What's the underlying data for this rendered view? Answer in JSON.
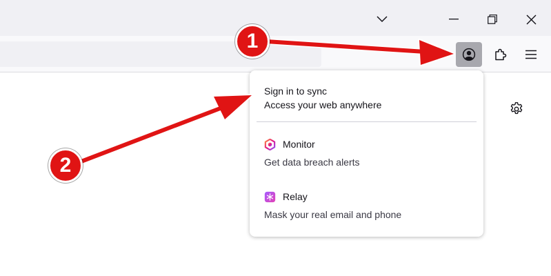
{
  "window": {
    "controls": {
      "tabs_dropdown_icon": "chevron-down-icon",
      "minimize_icon": "minimize-icon",
      "restore_icon": "restore-icon",
      "close_icon": "close-icon"
    }
  },
  "toolbar": {
    "account_icon": "account-icon",
    "extensions_icon": "puzzle-icon",
    "menu_icon": "hamburger-menu-icon"
  },
  "content": {
    "settings_icon": "gear-icon"
  },
  "account_panel": {
    "sync_title": "Sign in to sync",
    "sync_subtitle": "Access your web anywhere",
    "items": [
      {
        "icon": "monitor-icon",
        "title": "Monitor",
        "subtitle": "Get data breach alerts"
      },
      {
        "icon": "relay-icon",
        "title": "Relay",
        "subtitle": "Mask your real email and phone"
      }
    ]
  },
  "annotations": [
    {
      "label": "1"
    },
    {
      "label": "2"
    }
  ],
  "colors": {
    "annotation_red": "#e01414",
    "titlebar_bg": "#f0f0f4",
    "toolbar_bg": "#f9f9fb",
    "active_button_bg": "#a8a8ae"
  }
}
